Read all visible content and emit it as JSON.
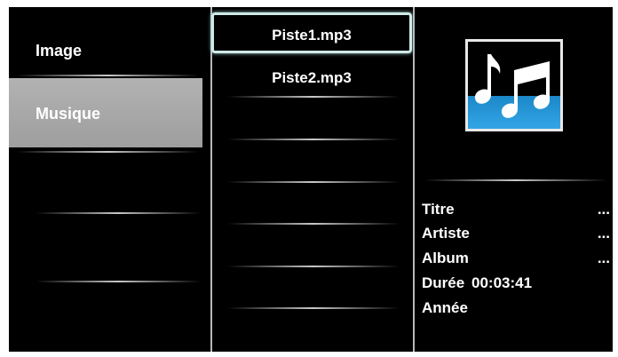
{
  "categories": {
    "image_label": "Image",
    "musique_label": "Musique"
  },
  "files": [
    {
      "name": "Piste1.mp3"
    },
    {
      "name": "Piste2.mp3"
    }
  ],
  "info": {
    "titre_label": "Titre",
    "titre_value": "...",
    "artiste_label": "Artiste",
    "artiste_value": "...",
    "album_label": "Album",
    "album_value": "...",
    "duree_label": "Durée",
    "duree_value": "00:03:41",
    "annee_label": "Année"
  },
  "icons": {
    "album_art": "music-notes-icon"
  },
  "colors": {
    "background": "#000000",
    "selected_category": "#a8a8a8",
    "focus_border": "#cfe9e6",
    "art_blue": "#1b87c8"
  }
}
